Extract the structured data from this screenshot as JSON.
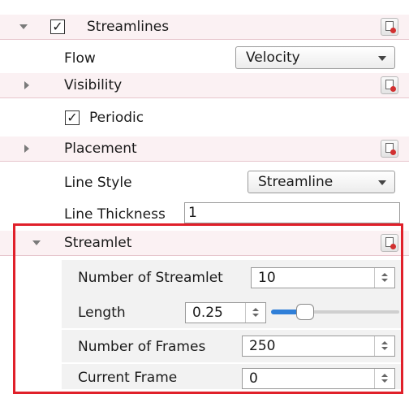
{
  "streamlines": {
    "label": "Streamlines",
    "checked": true,
    "check_glyph": "✓",
    "reset_icon": "reset-icon"
  },
  "flow": {
    "label": "Flow",
    "value": "Velocity"
  },
  "visibility": {
    "label": "Visibility"
  },
  "periodic": {
    "label": "Periodic",
    "check_glyph": "✓"
  },
  "placement": {
    "label": "Placement"
  },
  "line_style": {
    "label": "Line Style",
    "value": "Streamline"
  },
  "line_thickness": {
    "label": "Line Thickness",
    "value": "1"
  },
  "streamlet": {
    "label": "Streamlet",
    "number": {
      "label": "Number of Streamlet",
      "value": "10"
    },
    "length": {
      "label": "Length",
      "value": "0.25",
      "slider_fraction": 0.25
    },
    "frames": {
      "label": "Number of Frames",
      "value": "250"
    },
    "current_frame": {
      "label": "Current Frame",
      "value": "0"
    }
  },
  "colors": {
    "highlight": "#e0202a",
    "header_bg": "#fbf1f3",
    "slider_fill": "#2f7fd8"
  }
}
